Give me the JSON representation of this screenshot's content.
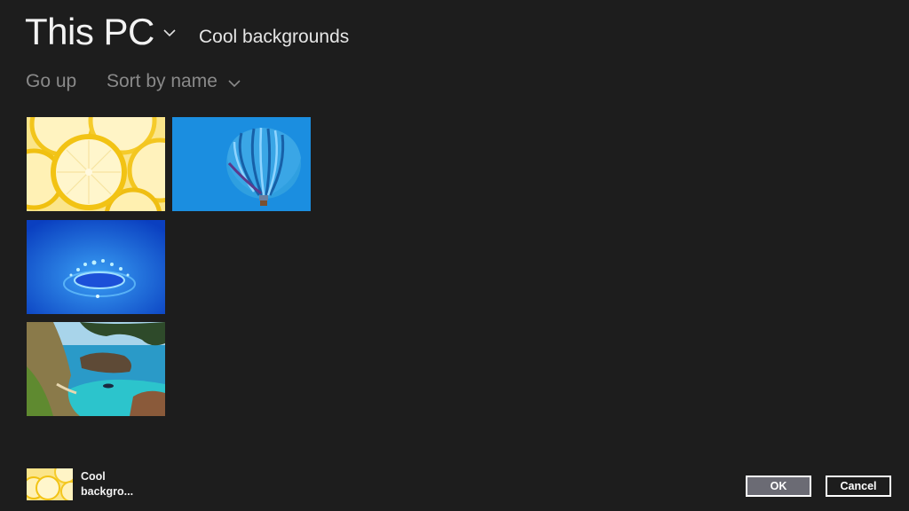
{
  "header": {
    "location": "This PC",
    "location_dropdown_icon": "chevron-down-icon",
    "current_folder": "Cool backgrounds"
  },
  "commands": {
    "go_up": "Go up",
    "sort": "Sort by name",
    "sort_dropdown_icon": "chevron-down-icon"
  },
  "files": [
    {
      "name": "lemon slices",
      "kind": "image",
      "selected": true
    },
    {
      "name": "hot air balloon",
      "kind": "image",
      "selected": false
    },
    {
      "name": "water drop splash",
      "kind": "image",
      "selected": false
    },
    {
      "name": "coastal cove",
      "kind": "image",
      "selected": false
    }
  ],
  "selection": {
    "label": "Cool backgro..."
  },
  "buttons": {
    "ok": "OK",
    "cancel": "Cancel"
  },
  "colors": {
    "background": "#1d1d1d",
    "ok_button": "#6b6b74"
  }
}
